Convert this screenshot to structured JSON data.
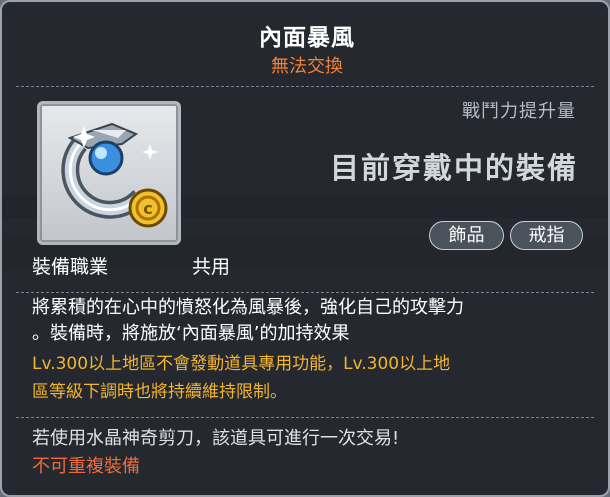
{
  "item": {
    "name": "內面暴風",
    "trade_status": "無法交換",
    "power_label": "戰鬥力提升量",
    "power_value": "目前穿戴中的裝備",
    "tags": [
      "飾品",
      "戒指"
    ],
    "job_label": "裝備職業",
    "job_value": "共用",
    "icon": "ring-icon"
  },
  "description": {
    "line1": "將累積的在心中的憤怒化為風暴後，強化自己的攻擊力",
    "line2": "。裝備時，將施放‘內面暴風’的加持效果",
    "notice1": "Lv.300以上地區不會發動道具專用功能，Lv.300以上地",
    "notice2": "區等級下調時也將持續維持限制。",
    "trade_note": "若使用水晶神奇剪刀，該道具可進行一次交易!",
    "unique_note": "不可重複裝備"
  },
  "colors": {
    "title": "#ffffff",
    "trade_status": "#f2823a",
    "notice": "#f2b52e",
    "unique": "#ef6a3a"
  }
}
